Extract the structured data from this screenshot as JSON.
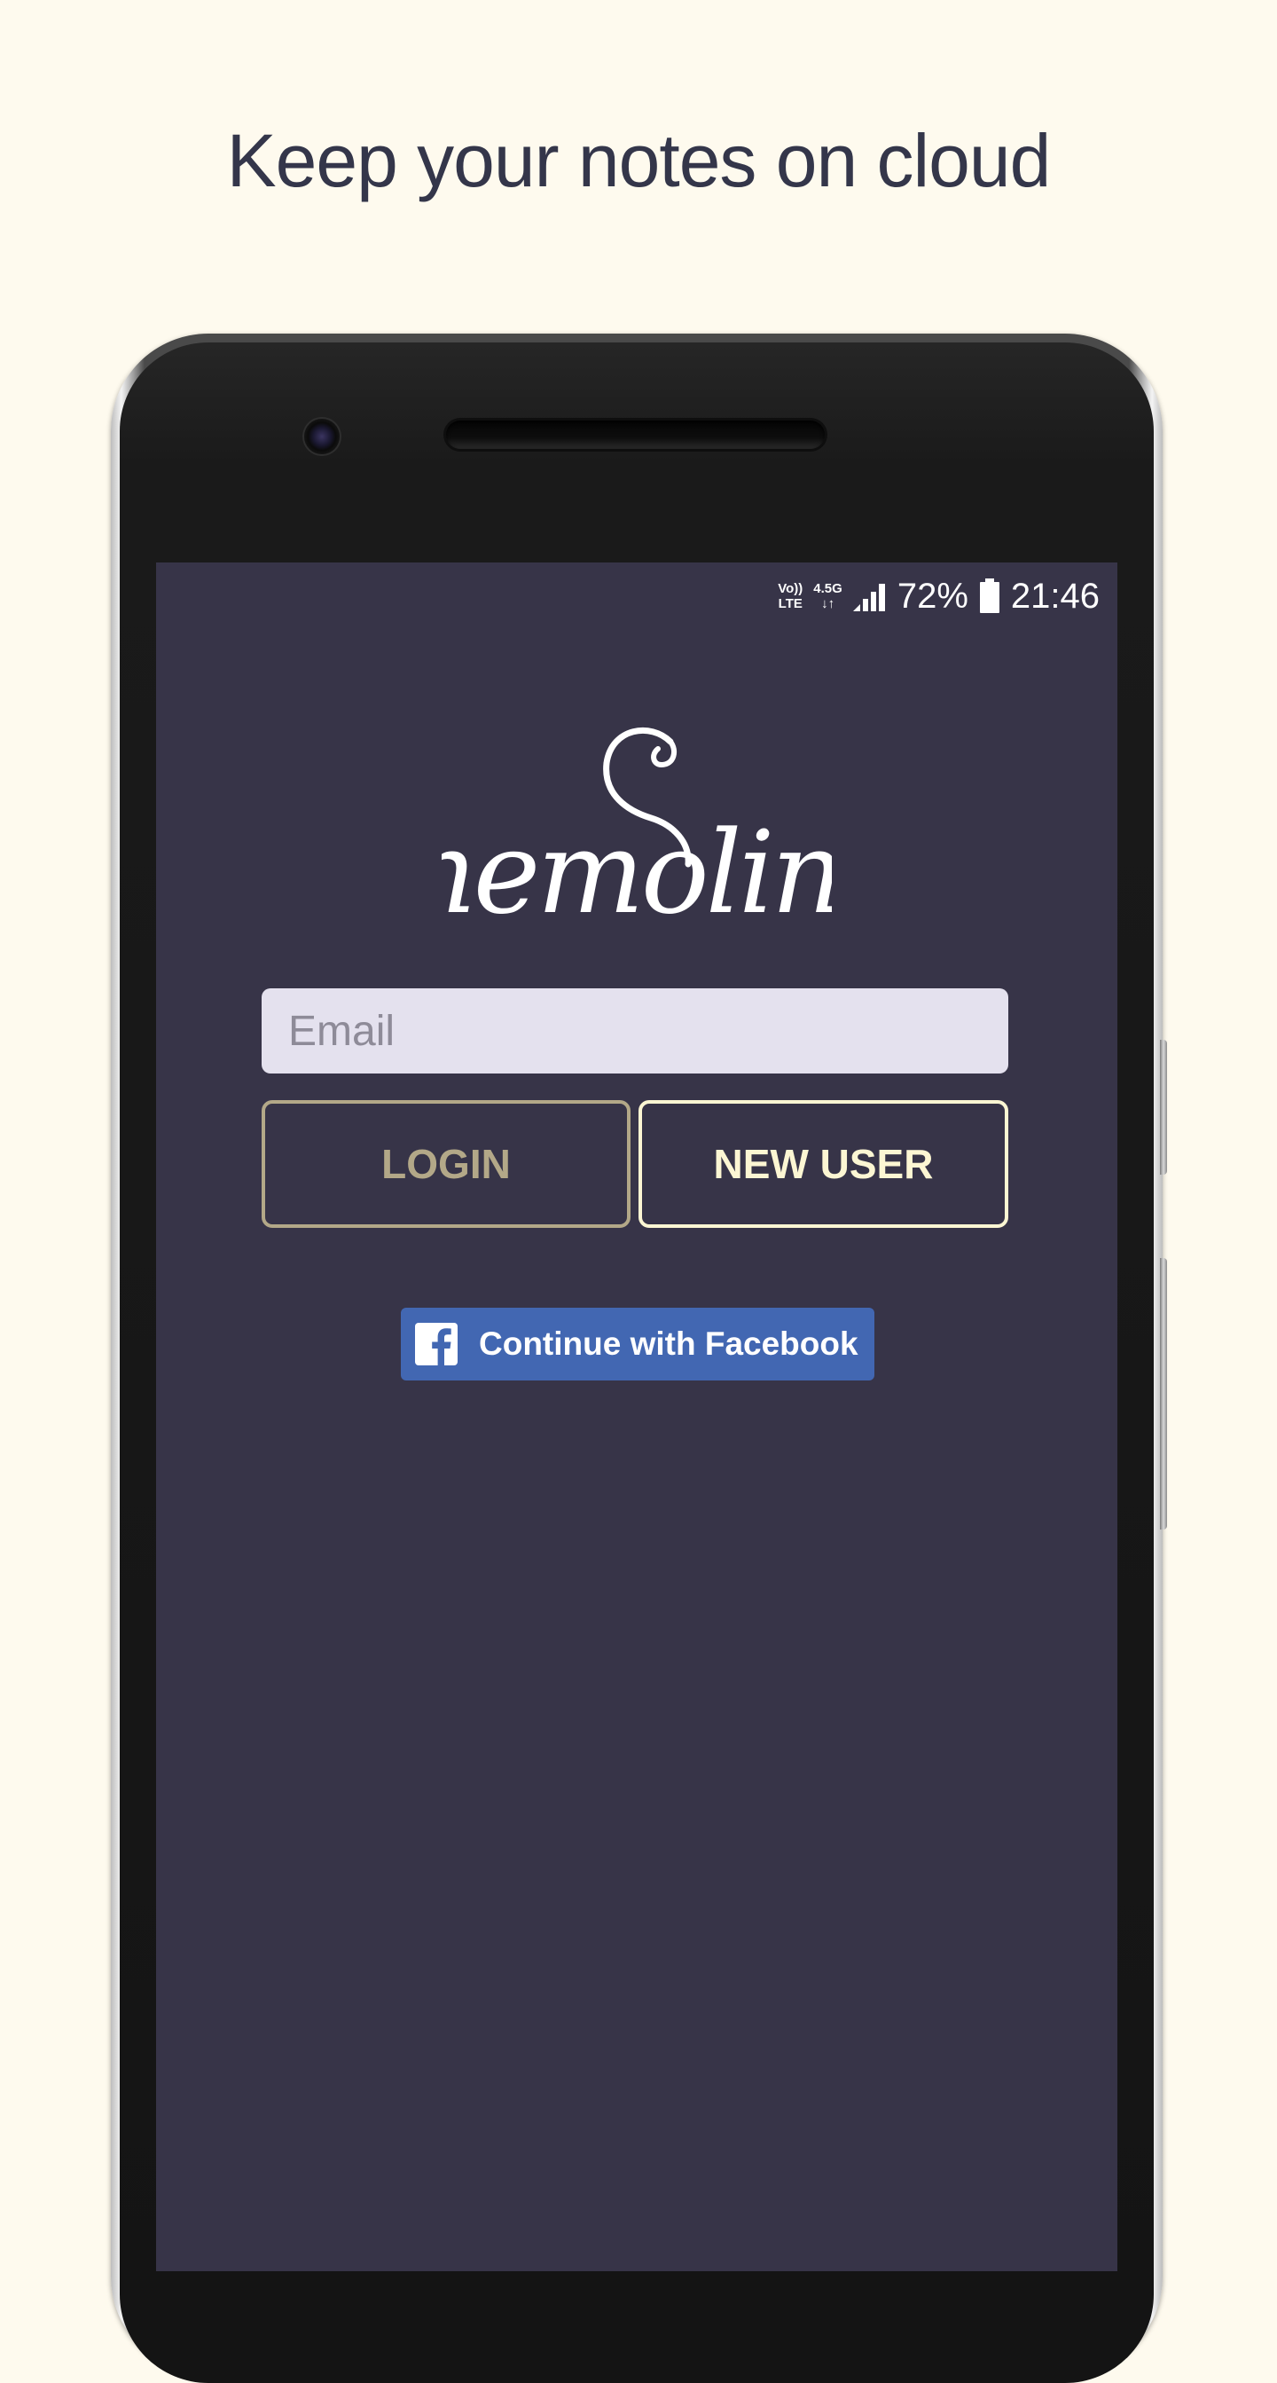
{
  "headline": "Keep your notes on cloud",
  "status_bar": {
    "volte_top": "Vo))",
    "volte_bottom": "LTE",
    "network_top": "4.5G",
    "network_bottom": "↓↑",
    "battery_percent": "72%",
    "time": "21:46"
  },
  "logo": {
    "text": "memoline"
  },
  "login_form": {
    "email_placeholder": "Email",
    "email_value": "",
    "login_label": "LOGIN",
    "new_user_label": "NEW USER",
    "facebook_label": "Continue with Facebook"
  },
  "colors": {
    "page_background": "#fefaee",
    "screen_background": "#373448",
    "email_field": "#e4e1ee",
    "login_accent": "#b3a888",
    "new_user_accent": "#fcf6d3",
    "facebook_blue": "#4267b2"
  },
  "icons": {
    "status": [
      "volte-icon",
      "network-icon",
      "signal-icon",
      "battery-icon"
    ],
    "facebook": "facebook-logo-icon"
  }
}
